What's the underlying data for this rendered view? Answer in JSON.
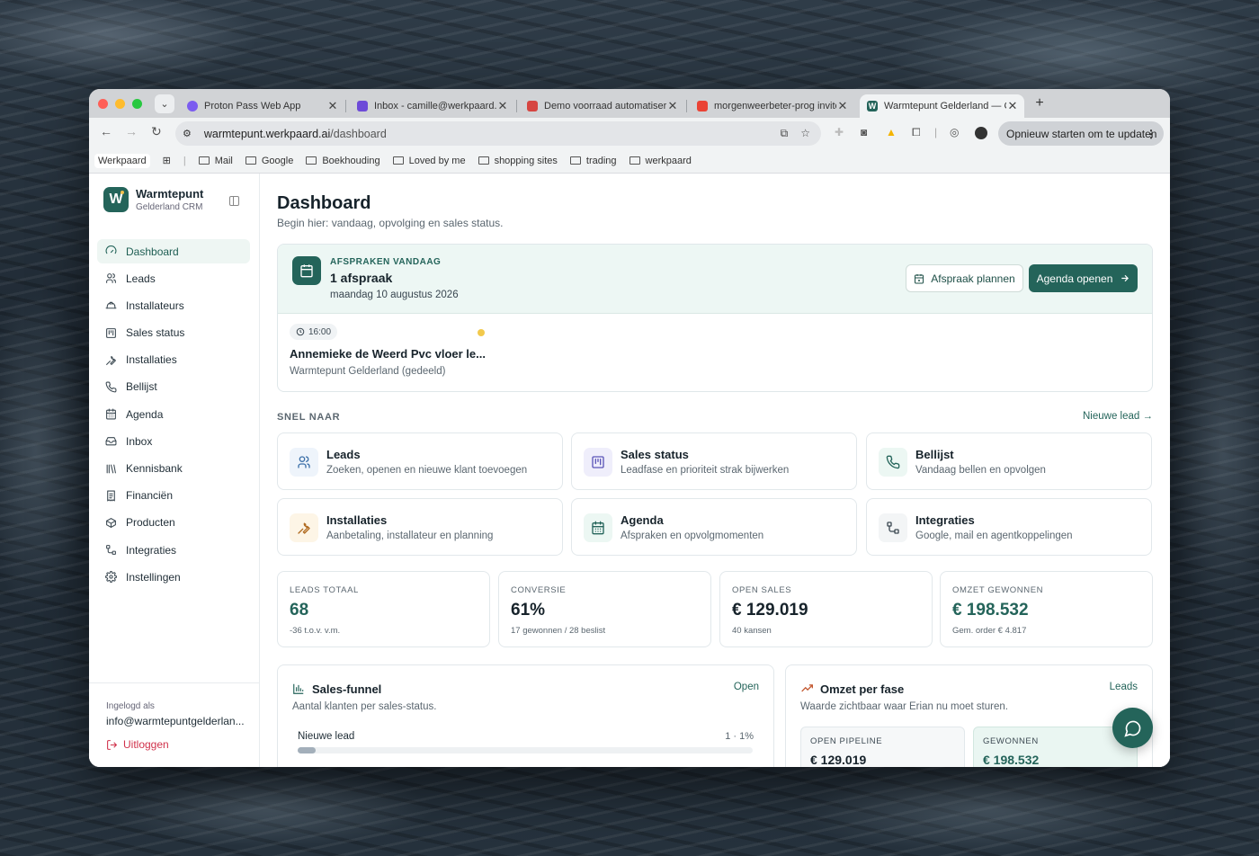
{
  "browser": {
    "tabs": [
      {
        "title": "Proton Pass Web App",
        "active": false
      },
      {
        "title": "Inbox - camille@werkpaard.ai",
        "active": false
      },
      {
        "title": "Demo voorraad automatiserin",
        "active": false
      },
      {
        "title": "morgenweerbeter-prog invite",
        "active": false
      },
      {
        "title": "Warmtepunt Gelderland — CR",
        "active": true
      }
    ],
    "url_host": "warmtepunt.werkpaard.ai",
    "url_path": "/dashboard",
    "update_button": "Opnieuw starten om te updaten",
    "bookmarks": [
      "Werkpaard",
      "Mail",
      "Google",
      "Boekhouding",
      "Loved by me",
      "shopping sites",
      "trading",
      "werkpaard"
    ]
  },
  "sidebar": {
    "brand_name": "Warmtepunt",
    "brand_sub": "Gelderland CRM",
    "logo_letter": "W",
    "items": [
      {
        "label": "Dashboard",
        "icon": "gauge-icon",
        "active": true
      },
      {
        "label": "Leads",
        "icon": "users-icon"
      },
      {
        "label": "Installateurs",
        "icon": "hard-hat-icon"
      },
      {
        "label": "Sales status",
        "icon": "kanban-icon"
      },
      {
        "label": "Installaties",
        "icon": "wrench-icon"
      },
      {
        "label": "Bellijst",
        "icon": "phone-icon"
      },
      {
        "label": "Agenda",
        "icon": "calendar-icon"
      },
      {
        "label": "Inbox",
        "icon": "inbox-icon"
      },
      {
        "label": "Kennisbank",
        "icon": "library-icon"
      },
      {
        "label": "Financiën",
        "icon": "receipt-icon"
      },
      {
        "label": "Producten",
        "icon": "package-icon"
      },
      {
        "label": "Integraties",
        "icon": "workflow-icon"
      },
      {
        "label": "Instellingen",
        "icon": "gear-icon"
      }
    ],
    "login_label": "Ingelogd als",
    "login_email": "info@warmtepuntgelderlan...",
    "logout": "Uitloggen"
  },
  "main": {
    "title": "Dashboard",
    "subtitle": "Begin hier: vandaag, opvolging en sales status.",
    "appointments": {
      "label": "AFSPRAKEN VANDAAG",
      "count": "1 afspraak",
      "date": "maandag 10 augustus 2026",
      "plan_button": "Afspraak plannen",
      "agenda_button": "Agenda openen",
      "item": {
        "time": "16:00",
        "title": "Annemieke de Weerd Pvc vloer le...",
        "org": "Warmtepunt Gelderland (gedeeld)"
      }
    },
    "quick": {
      "heading": "SNEL NAAR",
      "new_lead": "Nieuwe lead",
      "cards": [
        {
          "title": "Leads",
          "desc": "Zoeken, openen en nieuwe klant toevoegen",
          "icon": "users-icon",
          "tint": "#eef4fb",
          "color": "#3b6fa8"
        },
        {
          "title": "Sales status",
          "desc": "Leadfase en prioriteit strak bijwerken",
          "icon": "kanban-icon",
          "tint": "#efeefb",
          "color": "#5b55b8"
        },
        {
          "title": "Bellijst",
          "desc": "Vandaag bellen en opvolgen",
          "icon": "phone-icon",
          "tint": "#ecf7f3",
          "color": "#24645a"
        },
        {
          "title": "Installaties",
          "desc": "Aanbetaling, installateur en planning",
          "icon": "wrench-icon",
          "tint": "#fdf5e6",
          "color": "#b06a1f"
        },
        {
          "title": "Agenda",
          "desc": "Afspraken en opvolgmomenten",
          "icon": "calendar-icon",
          "tint": "#ecf7f3",
          "color": "#24645a"
        },
        {
          "title": "Integraties",
          "desc": "Google, mail en agentkoppelingen",
          "icon": "workflow-icon",
          "tint": "#f3f5f6",
          "color": "#3d4a53"
        }
      ]
    },
    "stats": [
      {
        "label": "LEADS TOTAAL",
        "value": "68",
        "detail": "-36 t.o.v. v.m.",
        "color": "#24645a"
      },
      {
        "label": "CONVERSIE",
        "value": "61%",
        "detail": "17 gewonnen / 28 beslist",
        "color": "#17232b"
      },
      {
        "label": "OPEN SALES",
        "value": "€ 129.019",
        "detail": "40 kansen",
        "color": "#17232b"
      },
      {
        "label": "OMZET GEWONNEN",
        "value": "€ 198.532",
        "detail": "Gem. order € 4.817",
        "color": "#24645a"
      }
    ],
    "funnel": {
      "title": "Sales-funnel",
      "link": "Open",
      "desc": "Aantal klanten per sales-status.",
      "stages": [
        {
          "label": "Nieuwe lead",
          "value": "1 · 1%",
          "fraction": 0.04
        }
      ]
    },
    "revenue": {
      "title": "Omzet per fase",
      "link": "Leads",
      "desc": "Waarde zichtbaar waar Erian nu moet sturen.",
      "blocks": [
        {
          "label": "OPEN PIPELINE",
          "value": "€ 129.019"
        },
        {
          "label": "GEWONNEN",
          "value": "€ 198.532"
        }
      ]
    }
  },
  "colors": {
    "accent": "#24645a",
    "accent_light": "#edf7f4",
    "danger": "#d0324b"
  }
}
